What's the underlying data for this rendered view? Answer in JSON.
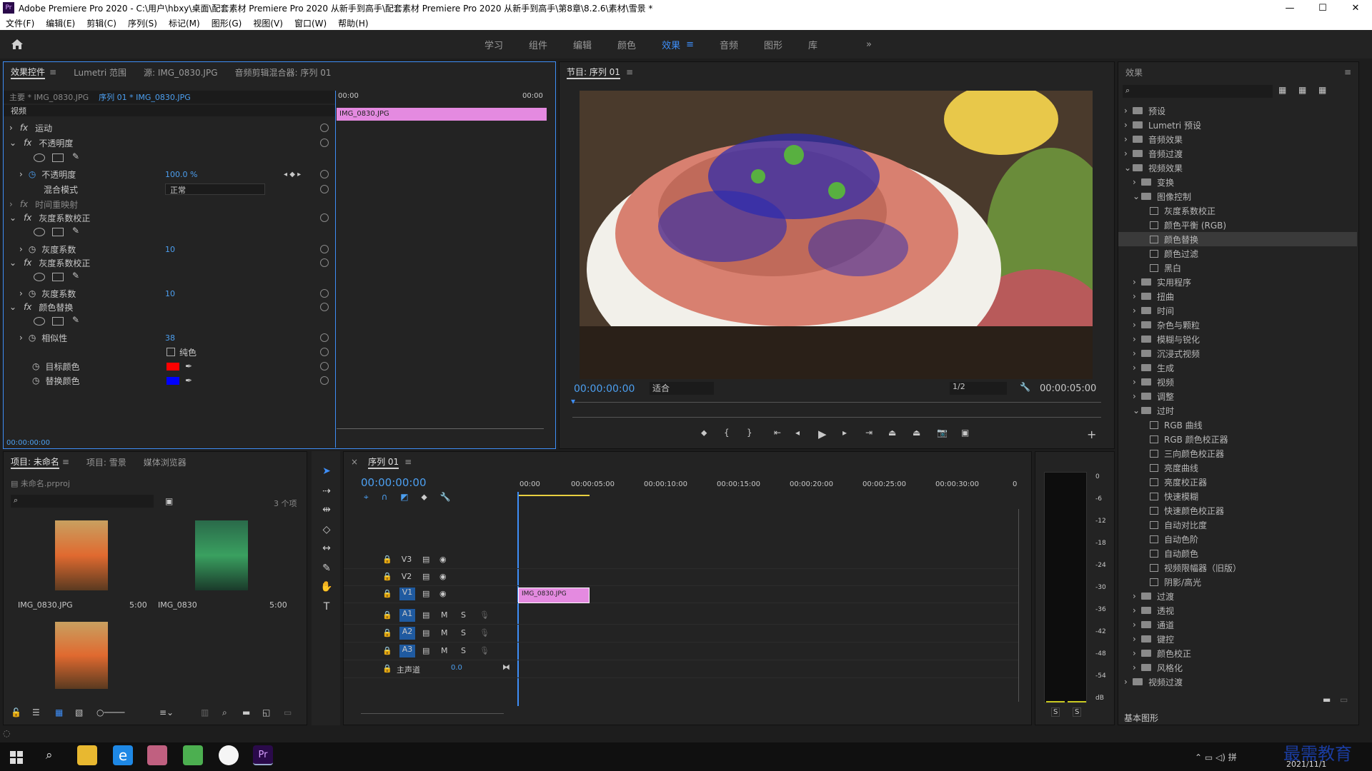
{
  "window": {
    "title": "Adobe Premiere Pro 2020 - C:\\用户\\hbxy\\桌面\\配套素材 Premiere Pro 2020 从新手到高手\\配套素材 Premiere Pro 2020 从新手到高手\\第8章\\8.2.6\\素材\\雪景 *",
    "minimize": "—",
    "maximize": "☐",
    "close": "✕"
  },
  "menu": [
    "文件(F)",
    "编辑(E)",
    "剪辑(C)",
    "序列(S)",
    "标记(M)",
    "图形(G)",
    "视图(V)",
    "窗口(W)",
    "帮助(H)"
  ],
  "workspaces": {
    "tabs": [
      "学习",
      "组件",
      "编辑",
      "颜色",
      "效果",
      "音频",
      "图形",
      "库"
    ],
    "active": "效果",
    "more": "»"
  },
  "effect_controls": {
    "tabs": [
      "效果控件",
      "Lumetri 范围",
      "源: IMG_0830.JPG",
      "音频剪辑混合器: 序列 01"
    ],
    "source_label": "主要 * IMG_0830.JPG",
    "sequence_label": "序列 01 * IMG_0830.JPG",
    "time_start": "00:00",
    "time_end": "00:00",
    "clip_name": "IMG_0830.JPG",
    "section": "视频",
    "rows": [
      {
        "name": "运动"
      },
      {
        "name": "不透明度"
      },
      {
        "name": "不透明度",
        "value": "100.0 %"
      },
      {
        "name": "混合模式",
        "value": "正常"
      },
      {
        "name": "时间重映射"
      },
      {
        "name": "灰度系数校正"
      },
      {
        "name": "灰度系数",
        "value": "10"
      },
      {
        "name": "灰度系数校正"
      },
      {
        "name": "灰度系数",
        "value": "10"
      },
      {
        "name": "颜色替换"
      },
      {
        "name": "相似性",
        "value": "38"
      },
      {
        "name": "纯色"
      },
      {
        "name": "目标颜色"
      },
      {
        "name": "替换颜色"
      }
    ],
    "target_color": "#ff0000",
    "replace_color": "#0000ff",
    "timecode": "00:00:00:00"
  },
  "program": {
    "title": "节目: 序列 01",
    "timecode": "00:00:00:00",
    "fit": "适合",
    "resolution": "1/2",
    "duration": "00:00:05:00"
  },
  "project": {
    "tabs": [
      "项目: 未命名",
      "项目: 雪景",
      "媒体浏览器"
    ],
    "file": "未命名.prproj",
    "count": "3 个项",
    "items": [
      {
        "name": "IMG_0830.JPG",
        "duration": "5:00"
      },
      {
        "name": "IMG_0830",
        "duration": "5:00"
      },
      {
        "name": "",
        "duration": ""
      }
    ]
  },
  "timeline": {
    "title": "序列 01",
    "timecode": "00:00:00:00",
    "ruler": [
      "00:00",
      "00:00:05:00",
      "00:00:10:00",
      "00:00:15:00",
      "00:00:20:00",
      "00:00:25:00",
      "00:00:30:00",
      "0"
    ],
    "video_tracks": [
      "V3",
      "V2",
      "V1"
    ],
    "audio_tracks": [
      "A1",
      "A2",
      "A3"
    ],
    "master": "主声道",
    "master_value": "0.0",
    "clip": "IMG_0830.JPG",
    "m": "M",
    "s": "S"
  },
  "meter": {
    "scale": [
      "0",
      "-6",
      "-12",
      "-18",
      "-24",
      "-30",
      "-36",
      "-42",
      "-48",
      "-54",
      "dB"
    ],
    "solo": [
      "S",
      "S"
    ]
  },
  "effects": {
    "title": "效果",
    "footer": "基本图形",
    "tree": [
      {
        "label": "预设",
        "level": 0,
        "open": false
      },
      {
        "label": "Lumetri 预设",
        "level": 0,
        "open": false
      },
      {
        "label": "音频效果",
        "level": 0,
        "open": false
      },
      {
        "label": "音频过渡",
        "level": 0,
        "open": false
      },
      {
        "label": "视频效果",
        "level": 0,
        "open": true
      },
      {
        "label": "变换",
        "level": 1,
        "open": false
      },
      {
        "label": "图像控制",
        "level": 1,
        "open": true
      },
      {
        "label": "灰度系数校正",
        "level": 2
      },
      {
        "label": "颜色平衡 (RGB)",
        "level": 2
      },
      {
        "label": "颜色替换",
        "level": 2,
        "selected": true
      },
      {
        "label": "颜色过滤",
        "level": 2
      },
      {
        "label": "黑白",
        "level": 2
      },
      {
        "label": "实用程序",
        "level": 1,
        "open": false
      },
      {
        "label": "扭曲",
        "level": 1,
        "open": false
      },
      {
        "label": "时间",
        "level": 1,
        "open": false
      },
      {
        "label": "杂色与颗粒",
        "level": 1,
        "open": false
      },
      {
        "label": "模糊与锐化",
        "level": 1,
        "open": false
      },
      {
        "label": "沉浸式视频",
        "level": 1,
        "open": false
      },
      {
        "label": "生成",
        "level": 1,
        "open": false
      },
      {
        "label": "视频",
        "level": 1,
        "open": false
      },
      {
        "label": "调整",
        "level": 1,
        "open": false
      },
      {
        "label": "过时",
        "level": 1,
        "open": true
      },
      {
        "label": "RGB 曲线",
        "level": 2
      },
      {
        "label": "RGB 颜色校正器",
        "level": 2
      },
      {
        "label": "三向颜色校正器",
        "level": 2
      },
      {
        "label": "亮度曲线",
        "level": 2
      },
      {
        "label": "亮度校正器",
        "level": 2
      },
      {
        "label": "快速模糊",
        "level": 2
      },
      {
        "label": "快速颜色校正器",
        "level": 2
      },
      {
        "label": "自动对比度",
        "level": 2
      },
      {
        "label": "自动色阶",
        "level": 2
      },
      {
        "label": "自动颜色",
        "level": 2
      },
      {
        "label": "视频限幅器（旧版）",
        "level": 2
      },
      {
        "label": "阴影/高光",
        "level": 2
      },
      {
        "label": "过渡",
        "level": 1,
        "open": false
      },
      {
        "label": "透视",
        "level": 1,
        "open": false
      },
      {
        "label": "通道",
        "level": 1,
        "open": false
      },
      {
        "label": "键控",
        "level": 1,
        "open": false
      },
      {
        "label": "颜色校正",
        "level": 1,
        "open": false
      },
      {
        "label": "风格化",
        "level": 1,
        "open": false
      },
      {
        "label": "视频过渡",
        "level": 0,
        "open": false
      }
    ]
  },
  "taskbar": {
    "date": "2021/11/1",
    "watermark": "最需教育"
  }
}
